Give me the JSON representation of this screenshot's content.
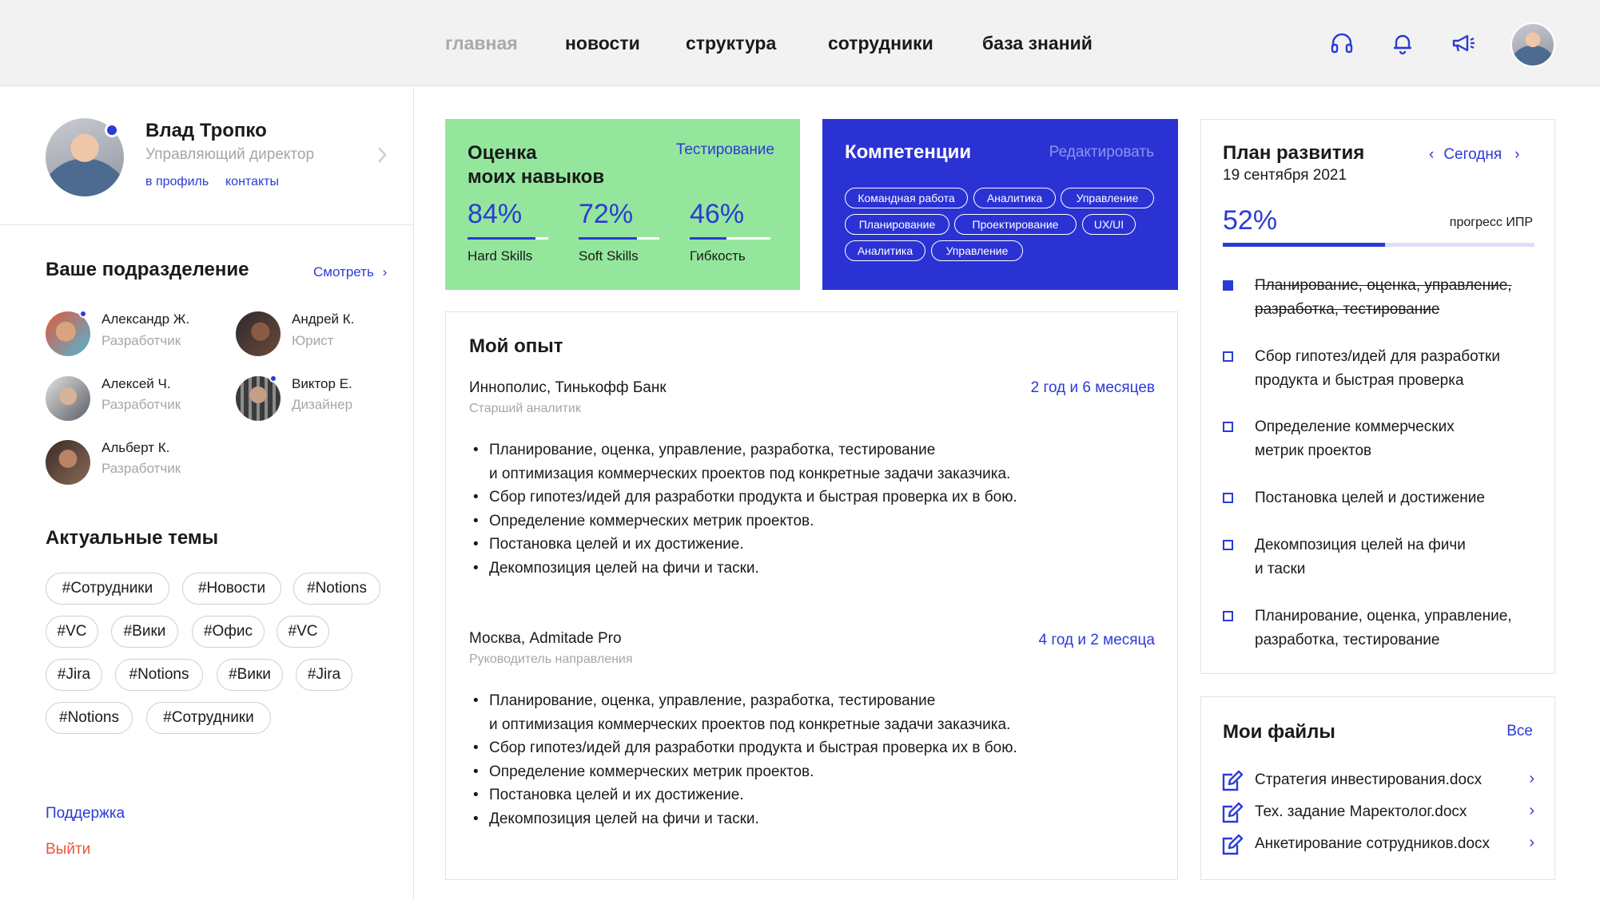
{
  "nav": {
    "items": [
      "главная",
      "новости",
      "структура",
      "сотрудники",
      "база знаний"
    ],
    "active_index": 0,
    "icons": [
      "headphones-icon",
      "bell-icon",
      "megaphone-icon"
    ]
  },
  "profile": {
    "name": "Влад Тропко",
    "title": "Управляющий директор",
    "profile_link": "в профиль",
    "contacts_link": "контакты"
  },
  "department": {
    "title": "Ваше подразделение",
    "view_link": "Смотреть",
    "members": [
      {
        "name": "Александр Ж.",
        "role": "Разработчик"
      },
      {
        "name": "Андрей К.",
        "role": "Юрист"
      },
      {
        "name": "Алексей Ч.",
        "role": "Разработчик"
      },
      {
        "name": "Виктор Е.",
        "role": "Дизайнер"
      },
      {
        "name": "Альберт К.",
        "role": "Разработчик"
      }
    ]
  },
  "topics": {
    "title": "Актуальные темы",
    "tags": [
      "#Сотрудники",
      "#Новости",
      "#Notions",
      "#VC",
      "#Вики",
      "#Офис",
      "#VC",
      "#Jira",
      "#Notions",
      "#Вики",
      "#Jira",
      "#Notions",
      "#Сотрудники"
    ]
  },
  "footer": {
    "support": "Поддержка",
    "logout": "Выйти"
  },
  "skills": {
    "title_line1": "Оценка",
    "title_line2": "моих навыков",
    "action": "Тестирование",
    "items": [
      {
        "value": "84%",
        "label": "Hard Skills",
        "progress": 0.84
      },
      {
        "value": "72%",
        "label": "Soft Skills",
        "progress": 0.72
      },
      {
        "value": "46%",
        "label": "Гибкость",
        "progress": 0.46
      }
    ]
  },
  "competencies": {
    "title": "Компетенции",
    "action": "Редактировать",
    "pills": [
      "Командная работа",
      "Аналитика",
      "Управление",
      "Планирование",
      "Проектирование",
      "UX/UI",
      "Аналитика",
      "Управление"
    ]
  },
  "experience": {
    "title": "Мой опыт",
    "jobs": [
      {
        "company": "Иннополис, Тинькофф Банк",
        "duration": "2 год и 6 месяцев",
        "position": "Старший аналитик",
        "bullets": [
          "Планирование, оценка, управление, разработка, тестирование",
          "и оптимизация коммерческих проектов под конкретные задачи заказчика.",
          "Сбор гипотез/идей для разработки продукта и быстрая проверка их в бою.",
          "Определение коммерческих метрик проектов.",
          "Постановка целей и их достижение.",
          "Декомпозиция целей на фичи и таски."
        ]
      },
      {
        "company": "Москва, Admitade Pro",
        "duration": "4 год и 2 месяца",
        "position": "Руководитель направления",
        "bullets": [
          "Планирование, оценка, управление, разработка, тестирование",
          "и оптимизация коммерческих проектов под конкретные задачи заказчика.",
          "Сбор гипотез/идей для разработки продукта и быстрая проверка их в бою.",
          "Определение коммерческих метрик проектов.",
          "Постановка целей и их достижение.",
          "Декомпозиция целей на фичи и таски."
        ]
      }
    ]
  },
  "plan": {
    "title": "План развития",
    "date": "19 сентября 2021",
    "period": "Сегодня",
    "progress_value": "52%",
    "progress": 0.52,
    "progress_label": "прогресс ИПР",
    "tasks": [
      {
        "line1": "Планирование, оценка, управление,",
        "line2": "разработка, тестирование",
        "done": true
      },
      {
        "line1": "Сбор гипотез/идей для разработки",
        "line2": "продукта и быстрая проверка",
        "done": false
      },
      {
        "line1": "Определение коммерческих",
        "line2": "метрик проектов",
        "done": false
      },
      {
        "line1": "Постановка целей и достижение",
        "line2": "",
        "done": false
      },
      {
        "line1": "Декомпозиция целей на фичи",
        "line2": "и таски",
        "done": false
      },
      {
        "line1": "Планирование, оценка, управление,",
        "line2": "разработка, тестирование",
        "done": false
      }
    ]
  },
  "files": {
    "title": "Мои файлы",
    "all_link": "Все",
    "items": [
      "Стратегия инвестирования.docx",
      "Тех. задание Маректолог.docx",
      "Анкетирование сотрудников.docx"
    ]
  },
  "colors": {
    "accent": "#2b3bd6",
    "green_card": "#94e69d",
    "blue_card": "#2b32d4",
    "logout": "#e8553a"
  }
}
